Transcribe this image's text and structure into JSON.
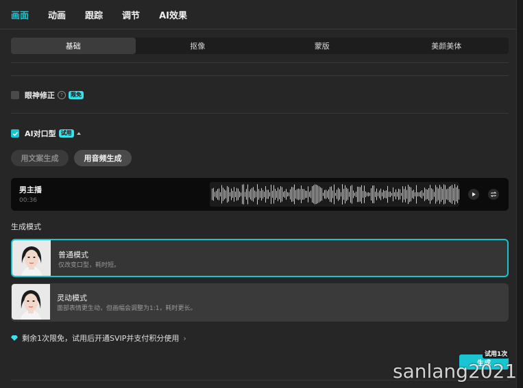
{
  "tabs": [
    {
      "label": "画面",
      "active": true
    },
    {
      "label": "动画",
      "active": false
    },
    {
      "label": "跟踪",
      "active": false
    },
    {
      "label": "调节",
      "active": false
    },
    {
      "label": "AI效果",
      "active": false
    }
  ],
  "subtabs": [
    {
      "label": "基础",
      "active": true
    },
    {
      "label": "抠像",
      "active": false
    },
    {
      "label": "蒙版",
      "active": false
    },
    {
      "label": "美颜美体",
      "active": false
    }
  ],
  "eye_correction": {
    "label": "眼神修正",
    "checked": false,
    "badge": "限免",
    "help_icon": "question-icon"
  },
  "lip_sync": {
    "label": "AI对口型",
    "checked": true,
    "badge": "试用",
    "expanded": true
  },
  "gen_source": {
    "text_option": "用文案生成",
    "audio_option": "用音频生成",
    "selected": "用音频生成"
  },
  "audio": {
    "name": "男主播",
    "duration": "00:36",
    "play_icon": "play-icon",
    "replace_icon": "replace-icon"
  },
  "mode_section_label": "生成模式",
  "modes": [
    {
      "title": "普通模式",
      "desc": "仅改变口型，耗时短。",
      "selected": true
    },
    {
      "title": "灵动模式",
      "desc": "面部表情更生动，但画幅会调整为1:1，耗时更长。",
      "selected": false
    }
  ],
  "info_text": "剩余1次限免，试用后开通SVIP并支付积分使用",
  "generate": {
    "label": "生成",
    "badge": "试用1次"
  },
  "watermark": "sanlang2021",
  "colors": {
    "accent": "#18c5d0",
    "background": "#262626"
  }
}
